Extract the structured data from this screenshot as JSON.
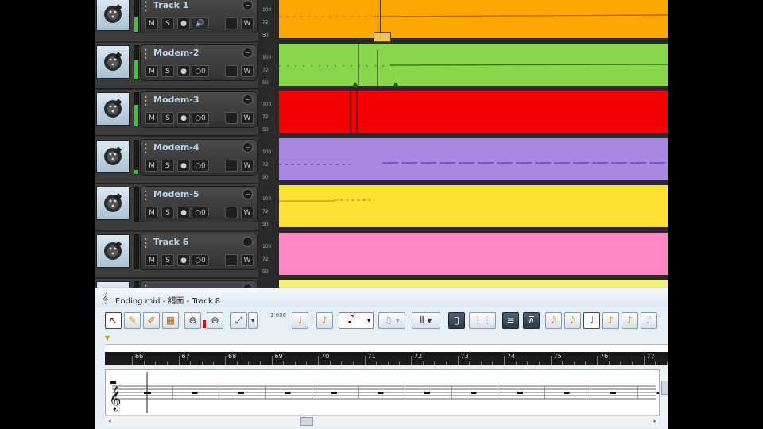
{
  "tracks": [
    {
      "name": "Track 1",
      "color": "#ffa500",
      "button_labels": [
        "M",
        "S",
        "●",
        "🔊",
        "",
        "W"
      ],
      "meter_level": 0.45
    },
    {
      "name": "Modem-2",
      "color": "#8ad64b",
      "button_labels": [
        "M",
        "S",
        "●",
        "○0",
        "",
        "W"
      ],
      "meter_level": 0.55
    },
    {
      "name": "Modem-3",
      "color": "#f50000",
      "button_labels": [
        "M",
        "S",
        "●",
        "○0",
        "",
        "W"
      ],
      "meter_level": 0.65
    },
    {
      "name": "Modem-4",
      "color": "#a888e4",
      "button_labels": [
        "M",
        "S",
        "●",
        "○0",
        "",
        "W"
      ],
      "meter_level": 0.1
    },
    {
      "name": "Modem-5",
      "color": "#ffe033",
      "button_labels": [
        "M",
        "S",
        "●",
        "○0",
        "",
        "W"
      ],
      "meter_level": 0
    },
    {
      "name": "Track 6",
      "color": "#ff88c4",
      "button_labels": [
        "M",
        "S",
        "●",
        "○0",
        "",
        "W"
      ],
      "meter_level": 0
    },
    {
      "name": "",
      "color": "#f3f07a",
      "button_labels": [],
      "meter_level": 0
    }
  ],
  "scale_labels": [
    "100",
    "72",
    "50"
  ],
  "editor": {
    "title": "Ending.mid - 譜面 - Track 8",
    "zoom_value": "1.000",
    "ruler_numbers": [
      "66",
      "67",
      "68",
      "69",
      "70",
      "71",
      "72",
      "73",
      "74",
      "75",
      "76",
      "77"
    ],
    "toolbar_icons": [
      "select-tool-icon",
      "draw-tool-icon",
      "erase-tool-icon",
      "paint-tool-icon",
      "zoom-out-icon",
      "zoom-in-icon",
      "snap-tool-icon",
      "dropdown-icon",
      "note-add-icon",
      "note-insert-icon",
      "note-value-select",
      "tuplet-select",
      "beam-select",
      "layout-icon",
      "split-icon",
      "notes-icon",
      "measure-icon",
      "note-type-16th-icon",
      "note-type-8th-icon",
      "note-type-quarter-icon",
      "note-type-half-icon",
      "note-type-whole-icon",
      "note-type-dotted-icon"
    ]
  }
}
